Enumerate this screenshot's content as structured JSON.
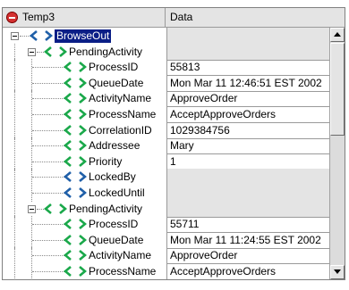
{
  "header": {
    "name_col": "Temp3",
    "data_col": "Data"
  },
  "colors": {
    "icon_blue": "#1f5fa8",
    "icon_green": "#1aa84a",
    "selection": "#0a1e86"
  },
  "rows": [
    {
      "label": "BrowseOut",
      "value": "",
      "icon": "blue",
      "selected": true,
      "grey": true
    },
    {
      "label": "PendingActivity",
      "value": "",
      "icon": "green",
      "grey": true
    },
    {
      "label": "ProcessID",
      "value": "55813",
      "icon": "green"
    },
    {
      "label": "QueueDate",
      "value": "Mon Mar 11 12:46:51 EST 2002",
      "icon": "green"
    },
    {
      "label": "ActivityName",
      "value": "ApproveOrder",
      "icon": "green"
    },
    {
      "label": "ProcessName",
      "value": "AcceptApproveOrders",
      "icon": "green"
    },
    {
      "label": "CorrelationID",
      "value": "1029384756",
      "icon": "green"
    },
    {
      "label": "Addressee",
      "value": "Mary",
      "icon": "green"
    },
    {
      "label": "Priority",
      "value": "1",
      "icon": "green"
    },
    {
      "label": "LockedBy",
      "value": "",
      "icon": "blue",
      "grey": true
    },
    {
      "label": "LockedUntil",
      "value": "",
      "icon": "blue",
      "grey": true
    },
    {
      "label": "PendingActivity",
      "value": "",
      "icon": "green",
      "grey": true
    },
    {
      "label": "ProcessID",
      "value": "55711",
      "icon": "green"
    },
    {
      "label": "QueueDate",
      "value": "Mon Mar 11 11:24:55 EST 2002",
      "icon": "green"
    },
    {
      "label": "ActivityName",
      "value": "ApproveOrder",
      "icon": "green"
    },
    {
      "label": "ProcessName",
      "value": "AcceptApproveOrders",
      "icon": "green"
    }
  ]
}
